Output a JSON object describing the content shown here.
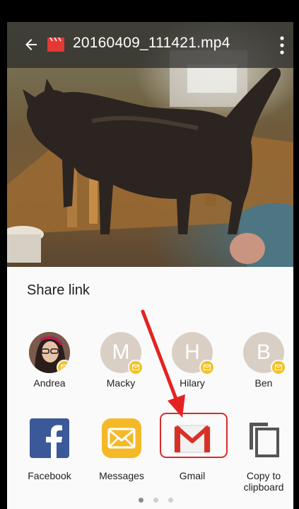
{
  "app_bar": {
    "title": "20160409_111421.mp4",
    "back_icon": "arrow-left-icon",
    "file_icon": "video-clapper-icon",
    "menu_icon": "more-vert-icon"
  },
  "share_sheet": {
    "title": "Share link",
    "contacts": [
      {
        "name": "Andrea",
        "initial": ""
      },
      {
        "name": "Macky",
        "initial": "M"
      },
      {
        "name": "Hilary",
        "initial": "H"
      },
      {
        "name": "Ben",
        "initial": "B"
      }
    ],
    "apps": [
      {
        "label": "Facebook"
      },
      {
        "label": "Messages"
      },
      {
        "label": "Gmail"
      },
      {
        "label_line1": "Copy to",
        "label_line2": "clipboard"
      }
    ],
    "page_indicator": {
      "pages": 3,
      "current": 1
    }
  },
  "colors": {
    "badge": "#f5c221",
    "facebook": "#3b5998",
    "messages": "#f5b928",
    "gmail_red": "#d93025",
    "annotation_red": "#e52222"
  }
}
